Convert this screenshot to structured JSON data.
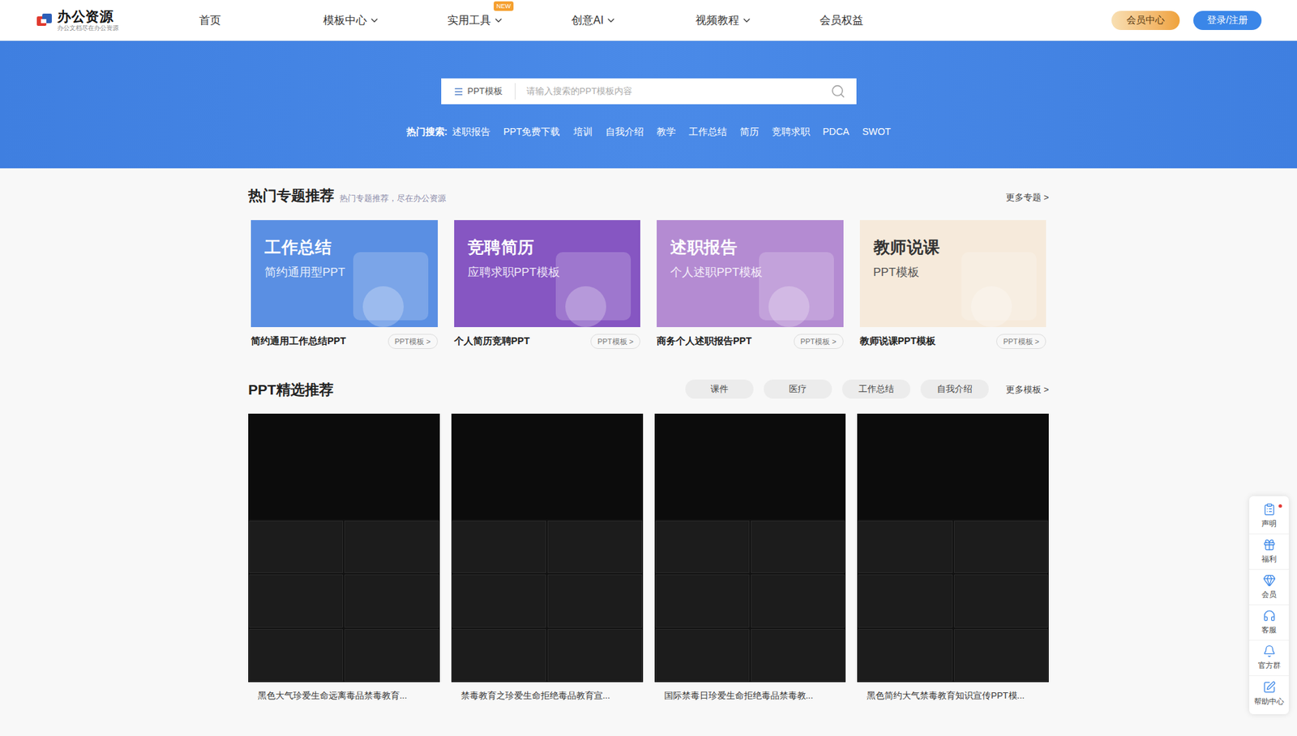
{
  "header": {
    "logo": {
      "name": "办公资源",
      "tagline": "办公文档尽在办公资源"
    },
    "nav": [
      {
        "label": "首页",
        "dropdown": false,
        "badge": ""
      },
      {
        "label": "模板中心",
        "dropdown": true,
        "badge": ""
      },
      {
        "label": "实用工具",
        "dropdown": true,
        "badge": "NEW"
      },
      {
        "label": "创意AI",
        "dropdown": true,
        "badge": ""
      },
      {
        "label": "视频教程",
        "dropdown": true,
        "badge": ""
      },
      {
        "label": "会员权益",
        "dropdown": false,
        "badge": ""
      }
    ],
    "member_button": "会员中心",
    "login_button": "登录/注册"
  },
  "search": {
    "category": "PPT模板",
    "placeholder": "请输入搜索的PPT模板内容",
    "hot_label": "热门搜索:",
    "hot": [
      "述职报告",
      "PPT免费下载",
      "培训",
      "自我介绍",
      "教学",
      "工作总结",
      "简历",
      "竞聘求职",
      "PDCA",
      "SWOT"
    ]
  },
  "topics": {
    "title": "热门专题推荐",
    "subtitle": "热门专题推荐，尽在办公资源",
    "more": "更多专题 >",
    "cards": [
      {
        "banner_title": "工作总结",
        "banner_subtitle": "简约通用型PPT",
        "caption": "简约通用工作总结PPT",
        "tag": "PPT模板 >",
        "color": "#5a8fe3",
        "kind": "dark"
      },
      {
        "banner_title": "竞聘简历",
        "banner_subtitle": "应聘求职PPT模板",
        "caption": "个人简历竞聘PPT",
        "tag": "PPT模板 >",
        "color": "#8656c2",
        "kind": "dark"
      },
      {
        "banner_title": "述职报告",
        "banner_subtitle": "个人述职PPT模板",
        "caption": "商务个人述职报告PPT",
        "tag": "PPT模板 >",
        "color": "#b48bd2",
        "kind": "dark"
      },
      {
        "banner_title": "教师说课",
        "banner_subtitle": "PPT模板",
        "caption": "教师说课PPT模板",
        "tag": "PPT模板 >",
        "color": "#f6eadb",
        "kind": "light"
      }
    ]
  },
  "templates": {
    "title": "PPT精选推荐",
    "tags": [
      "课件",
      "医疗",
      "工作总结",
      "自我介绍"
    ],
    "more": "更多模板 >",
    "items": [
      {
        "caption": "黑色大气珍爱生命远离毒品禁毒教育..."
      },
      {
        "caption": "禁毒教育之珍爱生命拒绝毒品教育宣..."
      },
      {
        "caption": "国际禁毒日珍爱生命拒绝毒品禁毒教..."
      },
      {
        "caption": "黑色简约大气禁毒教育知识宣传PPT模..."
      }
    ]
  },
  "sidebar": [
    {
      "label": "声明",
      "dot": true
    },
    {
      "label": "福利",
      "dot": false
    },
    {
      "label": "会员",
      "dot": false
    },
    {
      "label": "客服",
      "dot": false
    },
    {
      "label": "官方群",
      "dot": false
    },
    {
      "label": "帮助中心",
      "dot": false
    }
  ]
}
